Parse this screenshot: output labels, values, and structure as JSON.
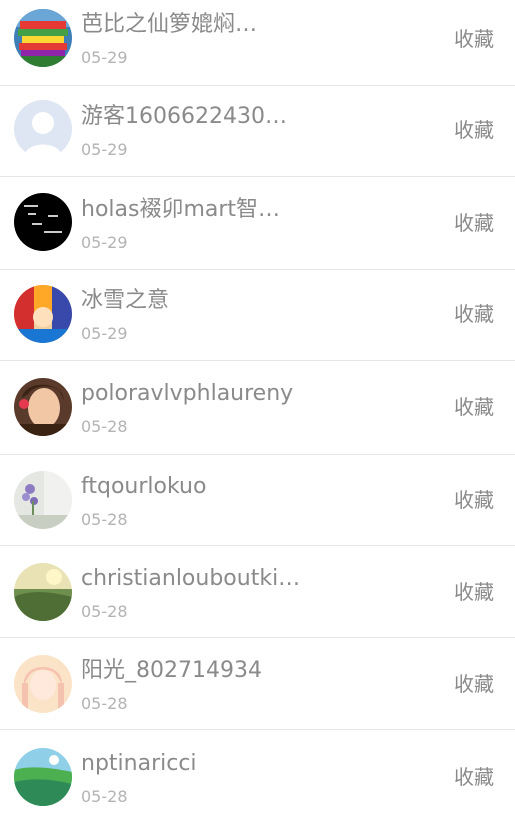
{
  "items": [
    {
      "name": "芭比之仙箩媲焖…",
      "date": "05-29",
      "action": "收藏",
      "avatar": "avatar-books-icon"
    },
    {
      "name": "游客1606622430…",
      "date": "05-29",
      "action": "收藏",
      "avatar": "avatar-default-user-icon"
    },
    {
      "name": "holas裰卯mart智…",
      "date": "05-29",
      "action": "收藏",
      "avatar": "avatar-black-text-icon"
    },
    {
      "name": "冰雪之意",
      "date": "05-29",
      "action": "收藏",
      "avatar": "avatar-anime-icon"
    },
    {
      "name": "poloravlvphlaureny",
      "date": "05-28",
      "action": "收藏",
      "avatar": "avatar-girl-portrait-icon"
    },
    {
      "name": "ftqourlokuo",
      "date": "05-28",
      "action": "收藏",
      "avatar": "avatar-lavender-icon"
    },
    {
      "name": "christianlouboutki…",
      "date": "05-28",
      "action": "收藏",
      "avatar": "avatar-landscape-icon"
    },
    {
      "name": "阳光_802714934",
      "date": "05-28",
      "action": "收藏",
      "avatar": "avatar-anime-girl-icon"
    },
    {
      "name": "nptinaricci",
      "date": "05-28",
      "action": "收藏",
      "avatar": "avatar-coast-icon"
    }
  ]
}
